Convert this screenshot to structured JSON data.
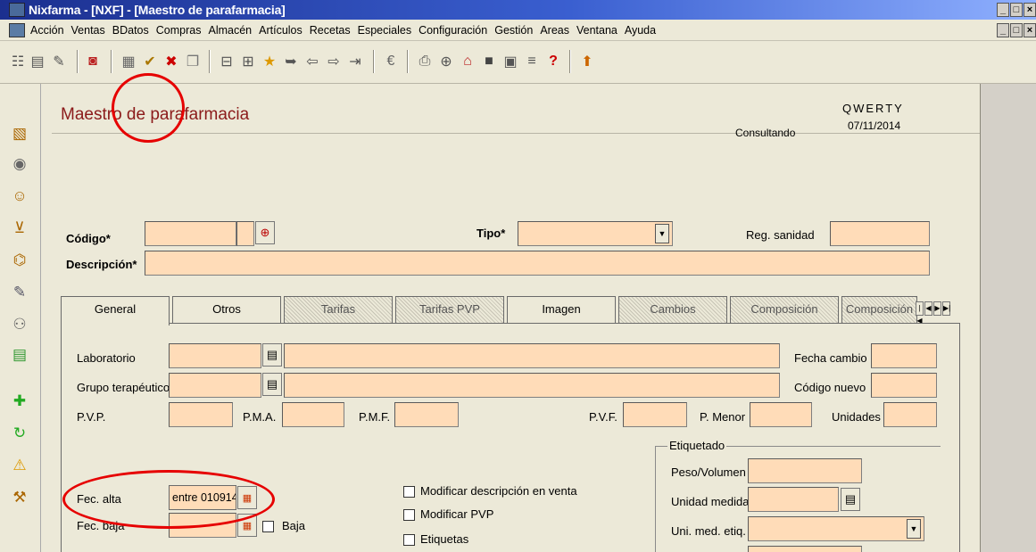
{
  "window": {
    "title": "Nixfarma - [NXF] - [Maestro de parafarmacia]",
    "controls": [
      "_",
      "□",
      "×"
    ]
  },
  "menu": [
    "Acción",
    "Ventas",
    "BDatos",
    "Compras",
    "Almacén",
    "Artículos",
    "Recetas",
    "Especiales",
    "Configuración",
    "Gestión",
    "Areas",
    "Ventana",
    "Ayuda"
  ],
  "form": {
    "title": "Maestro de parafarmacia",
    "user": "QWERTY",
    "mode": "Consultando",
    "date": "07/11/2014"
  },
  "header_fields": {
    "codigo_label": "Código*",
    "tipo_label": "Tipo*",
    "reg_sanidad_label": "Reg. sanidad",
    "descripcion_label": "Descripción*"
  },
  "tabs": [
    "General",
    "Otros",
    "Tarifas",
    "Tarifas PVP",
    "Imagen",
    "Cambios",
    "Composición",
    "Composición"
  ],
  "general": {
    "laboratorio": "Laboratorio",
    "grupo_terapeutico": "Grupo terapéutico",
    "fecha_cambio": "Fecha cambio",
    "codigo_nuevo": "Código nuevo",
    "pvp": "P.V.P.",
    "pma": "P.M.A.",
    "pmf": "P.M.F.",
    "pvf": "P.V.F.",
    "p_menor": "P. Menor",
    "unidades": "Unidades",
    "fec_alta": "Fec. alta",
    "fec_alta_value": "entre 010914",
    "fec_baja": "Fec. baja",
    "baja": "Baja",
    "modificar_desc": "Modificar descripción en venta",
    "modificar_pvp": "Modificar PVP",
    "etiquetas": "Etiquetas",
    "etiquetado": "Etiquetado",
    "peso_volumen": "Peso/Volumen",
    "unidad_medida": "Unidad medida",
    "uni_med_etiq": "Uni. med. etiq."
  },
  "colors": {
    "field_bg": "#ffdcb8",
    "title_red": "#8b1a1a",
    "highlight": "#e60000"
  }
}
